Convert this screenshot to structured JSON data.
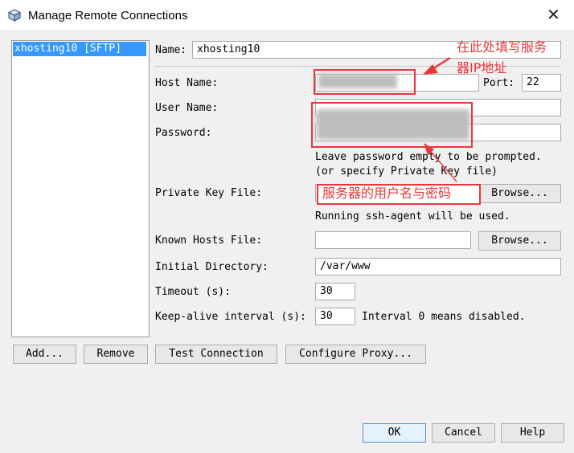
{
  "window": {
    "title": "Manage Remote Connections",
    "close_glyph": "✕"
  },
  "connections": {
    "items": [
      {
        "label": "xhosting10 [SFTP]"
      }
    ]
  },
  "form": {
    "name_label": "Name:",
    "name_value": "xhosting10",
    "host_label": "Host Name:",
    "host_value": "",
    "port_label": "Port:",
    "port_value": "22",
    "user_label": "User Name:",
    "user_value": "",
    "password_label": "Password:",
    "password_value": "",
    "password_hint_1": "Leave password empty to be prompted.",
    "password_hint_2": "(or specify Private Key file)",
    "private_key_label": "Private Key File:",
    "private_key_value": "",
    "browse_label": "Browse...",
    "ssh_agent_note": "Running ssh-agent will be used.",
    "known_hosts_label": "Known Hosts File:",
    "known_hosts_value": "",
    "initial_dir_label": "Initial Directory:",
    "initial_dir_value": "/var/www",
    "timeout_label": "Timeout (s):",
    "timeout_value": "30",
    "keepalive_label": "Keep-alive interval (s):",
    "keepalive_value": "30",
    "keepalive_note": "Interval 0 means disabled."
  },
  "buttons": {
    "add": "Add...",
    "remove": "Remove",
    "test": "Test Connection",
    "proxy": "Configure Proxy...",
    "ok": "OK",
    "cancel": "Cancel",
    "help": "Help"
  },
  "annotations": {
    "host_note_line1": "在此处填写服务",
    "host_note_line2": "器IP地址",
    "credentials_note": "服务器的用户名与密码",
    "color": "#e8373a"
  },
  "colors": {
    "selection": "#3399ff",
    "annotation": "#e8373a"
  }
}
